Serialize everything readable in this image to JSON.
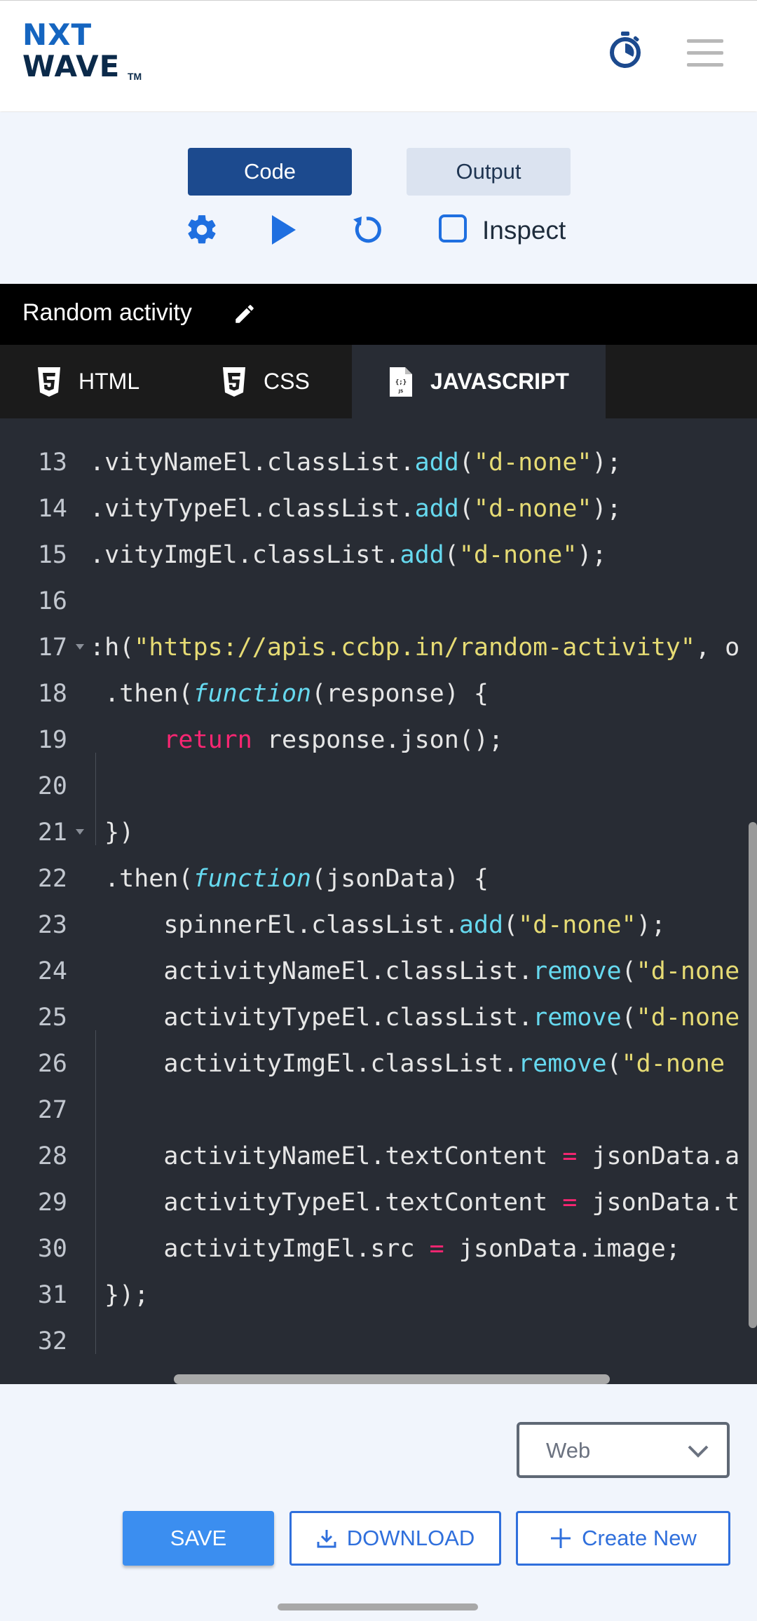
{
  "header": {
    "logo_top": "NXT",
    "logo_bottom": "WAVE",
    "logo_tm": "TM",
    "timer_icon": "stopwatch-icon",
    "menu_icon": "hamburger-menu-icon"
  },
  "controls": {
    "code_label": "Code",
    "output_label": "Output",
    "settings_icon": "gear-icon",
    "run_icon": "play-icon",
    "reset_icon": "refresh-icon",
    "inspect_label": "Inspect",
    "inspect_checked": false
  },
  "project": {
    "title": "Random activity",
    "edit_icon": "pencil-icon"
  },
  "tabs": [
    {
      "label": "HTML",
      "icon": "html5-icon",
      "active": false
    },
    {
      "label": "CSS",
      "icon": "css3-icon",
      "active": false
    },
    {
      "label": "JAVASCRIPT",
      "icon": "js-file-icon",
      "active": true
    }
  ],
  "editor": {
    "lines": [
      {
        "n": "13",
        "code": ".vityNameEl.classList.add(\"d-none\");"
      },
      {
        "n": "14",
        "code": ".vityTypeEl.classList.add(\"d-none\");"
      },
      {
        "n": "15",
        "code": ".vityImgEl.classList.add(\"d-none\");"
      },
      {
        "n": "16",
        "code": ""
      },
      {
        "n": "17",
        "code": ":h(\"https://apis.ccbp.in/random-activity\", o"
      },
      {
        "n": "18",
        "code": " .then(function(response) {"
      },
      {
        "n": "19",
        "code": "     return response.json();"
      },
      {
        "n": "20",
        "code": ""
      },
      {
        "n": "21",
        "code": " })"
      },
      {
        "n": "22",
        "code": " .then(function(jsonData) {"
      },
      {
        "n": "23",
        "code": "     spinnerEl.classList.add(\"d-none\");"
      },
      {
        "n": "24",
        "code": "     activityNameEl.classList.remove(\"d-none"
      },
      {
        "n": "25",
        "code": "     activityTypeEl.classList.remove(\"d-none"
      },
      {
        "n": "26",
        "code": "     activityImgEl.classList.remove(\"d-none"
      },
      {
        "n": "27",
        "code": ""
      },
      {
        "n": "28",
        "code": "     activityNameEl.textContent = jsonData.a"
      },
      {
        "n": "29",
        "code": "     activityTypeEl.textContent = jsonData.t"
      },
      {
        "n": "30",
        "code": "     activityImgEl.src = jsonData.image;"
      },
      {
        "n": "31",
        "code": " });"
      },
      {
        "n": "32",
        "code": ""
      }
    ]
  },
  "footer": {
    "device_select": "Web",
    "chevron_icon": "chevron-down-icon",
    "save_label": "SAVE",
    "download_label": "DOWNLOAD",
    "create_label": "Create New"
  },
  "colors": {
    "primary": "#1c4a8e",
    "accent": "#3b8ef0",
    "editor_bg": "#282c34",
    "string": "#e6db74",
    "method": "#66d9ef",
    "keyword": "#f92672"
  }
}
